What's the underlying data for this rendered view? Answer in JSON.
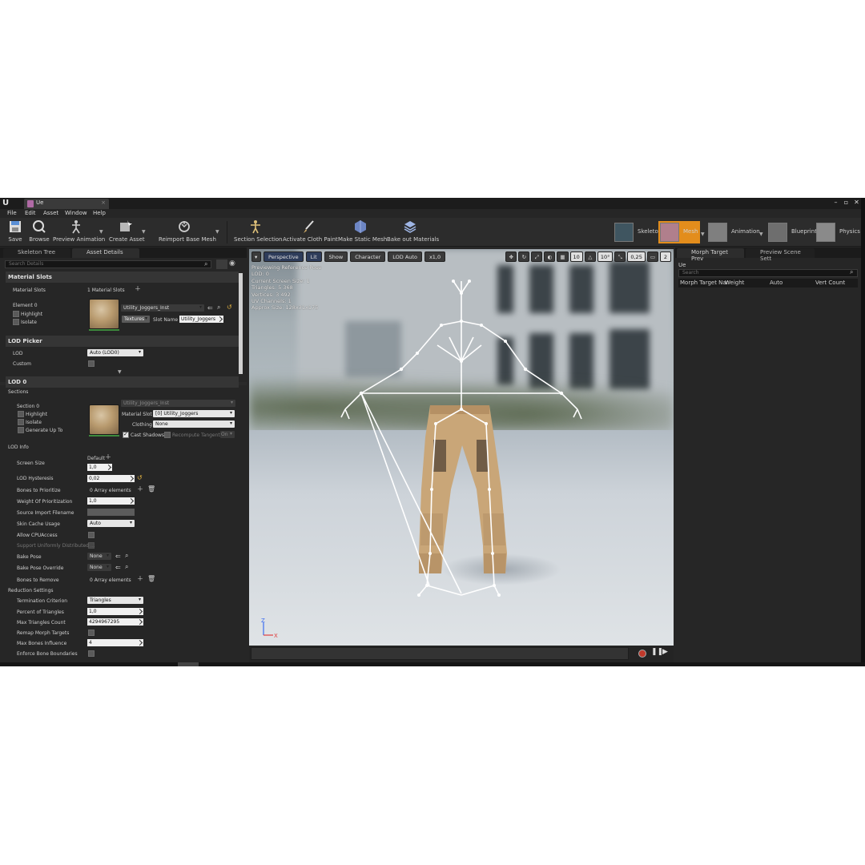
{
  "window": {
    "tab_title": "Ue",
    "tab_close": "×",
    "controls": [
      "–",
      "▫",
      "✕"
    ]
  },
  "menu": [
    "File",
    "Edit",
    "Asset",
    "Window",
    "Help"
  ],
  "toolbar": {
    "buttons": [
      {
        "label": "Save",
        "icon": "save-icon"
      },
      {
        "label": "Browse",
        "icon": "browse-icon"
      },
      {
        "label": "Preview Animation",
        "icon": "preview-animation-icon"
      },
      {
        "label": "Create Asset",
        "icon": "create-asset-icon"
      },
      {
        "label": "Reimport Base Mesh",
        "icon": "reimport-icon"
      },
      {
        "label": "Section Selection",
        "icon": "section-selection-icon"
      },
      {
        "label": "Activate Cloth Paint",
        "icon": "cloth-paint-icon"
      },
      {
        "label": "Make Static Mesh",
        "icon": "static-mesh-icon"
      },
      {
        "label": "Bake out Materials",
        "icon": "bake-materials-icon"
      }
    ],
    "modes": [
      {
        "label": "Skeleton",
        "active": false
      },
      {
        "label": "Mesh",
        "active": true
      },
      {
        "label": "Animation",
        "active": false
      },
      {
        "label": "Blueprint",
        "active": false
      },
      {
        "label": "Physics",
        "active": false
      }
    ],
    "accent_color": "#e38d1c"
  },
  "left_panel": {
    "tabs": [
      "Skeleton Tree",
      "Asset Details"
    ],
    "search_placeholder": "Search Details",
    "material_slots": {
      "header": "Material Slots",
      "row_label": "Material Slots",
      "count": "1 Material Slots",
      "element_label": "Element 0",
      "highlight": "Highlight",
      "isolate": "Isolate",
      "material": "Utility_Joggers_Inst",
      "textures_btn": "Textures",
      "slot_name_label": "Slot Name",
      "slot_name_value": "Utility_Joggers"
    },
    "lod_picker": {
      "header": "LOD Picker",
      "lod_label": "LOD",
      "lod_value": "Auto (LOD0)",
      "custom_label": "Custom"
    },
    "lod0": {
      "header": "LOD 0",
      "sections_label": "Sections",
      "section0": "Section 0",
      "highlight": "Highlight",
      "isolate": "Isolate",
      "generate_up_to": "Generate Up To",
      "material_greyed": "Utility_Joggers_Inst",
      "material_slot_label": "Material Slot",
      "material_slot_value": "[0] Utility_Joggers",
      "clothing_label": "Clothing",
      "clothing_value": "None",
      "cast_shadows": "Cast Shadows",
      "recompute_tangent": "Recompute Tangent",
      "recompute_value": "On"
    },
    "lod_info": {
      "header": "LOD Info",
      "screen_size_label": "Screen Size",
      "screen_size_default": "Default",
      "screen_size_value": "1,0",
      "hysteresis_label": "LOD Hysteresis",
      "hysteresis_value": "0,02",
      "bones_prioritize_label": "Bones to Prioritize",
      "bones_prioritize_value": "0 Array elements",
      "weight_prior_label": "Weight Of Prioritization",
      "weight_prior_value": "1,0",
      "source_import_label": "Source Import Filename",
      "skin_cache_label": "Skin Cache Usage",
      "skin_cache_value": "Auto",
      "allow_cpu_label": "Allow CPUAccess",
      "support_uniform_label": "Support Uniformly Distributed ...",
      "bake_pose_label": "Bake Pose",
      "bake_pose_value": "None",
      "bake_pose_override_label": "Bake Pose Override",
      "bake_pose_override_value": "None",
      "bones_remove_label": "Bones to Remove",
      "bones_remove_value": "0 Array elements"
    },
    "reduction": {
      "header": "Reduction Settings",
      "termination_label": "Termination Criterion",
      "termination_value": "Triangles",
      "percent_tri_label": "Percent of Triangles",
      "percent_tri_value": "1,0",
      "max_tri_label": "Max Triangles Count",
      "max_tri_value": "4294967295",
      "remap_label": "Remap Morph Targets",
      "max_bones_label": "Max Bones Influence",
      "max_bones_value": "4",
      "enforce_label": "Enforce Bone Boundaries"
    }
  },
  "viewport": {
    "buttons_left": [
      "Perspective",
      "Lit",
      "Show",
      "Character",
      "LOD Auto",
      "x1,0"
    ],
    "buttons_right": [
      "✥",
      "↻",
      "⤢",
      "◐",
      "▦",
      "10",
      "△",
      "10°",
      "⤡",
      "0,25",
      "▭",
      "2"
    ],
    "stats": [
      "Previewing Reference Pose",
      "LOD: 0",
      "Current Screen Size: 1",
      "Triangles: 5 368",
      "Vertices: 3 492",
      "UV Channels: 1",
      "Approx Size: 128x31x175"
    ],
    "axis_x": "X",
    "axis_z": "Z"
  },
  "right_panel": {
    "tabs": [
      "Morph Target Prev",
      "Preview Scene Sett"
    ],
    "title": "Ue",
    "search_placeholder": "Search",
    "columns": [
      "Morph Target Nar",
      "Weight",
      "Auto",
      "Vert Count"
    ]
  }
}
